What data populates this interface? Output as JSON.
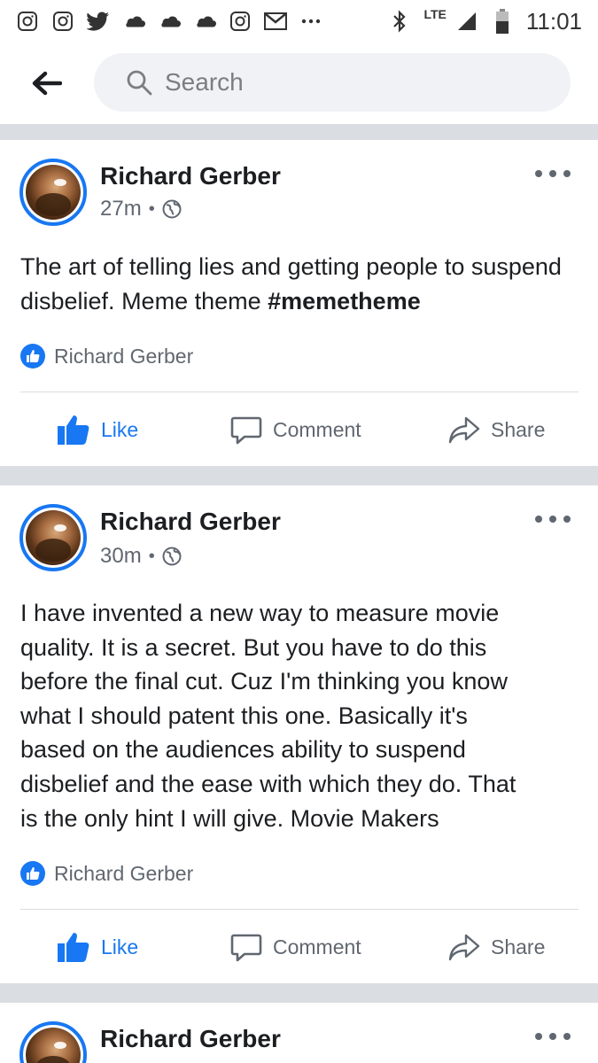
{
  "status_bar": {
    "time": "11:01",
    "network": "LTE",
    "icons": [
      "instagram-icon",
      "instagram-icon",
      "twitter-icon",
      "cloud-icon",
      "cloud-icon",
      "cloud-icon",
      "instagram-icon",
      "gmail-icon",
      "more-dots-icon",
      "bluetooth-icon",
      "signal-icon",
      "battery-icon"
    ]
  },
  "header": {
    "search_placeholder": "Search"
  },
  "posts": [
    {
      "author": "Richard Gerber",
      "time": "27m",
      "text_plain": "The art of telling lies and getting people to suspend disbelief. Meme theme ",
      "hashtag": "#memetheme",
      "reaction_name": "Richard Gerber",
      "like_label": "Like",
      "comment_label": "Comment",
      "share_label": "Share"
    },
    {
      "author": "Richard Gerber",
      "time": "30m",
      "text_lines": [
        "I have invented a new way to measure movie",
        "quality. It is a secret. But you have to do this",
        "before the final cut. Cuz I'm thinking you know",
        "what I should patent this one. Basically it's",
        "based on the audiences ability to suspend",
        "disbelief and the ease with which they do. That",
        "is the only hint I will give.  Movie Makers"
      ],
      "reaction_name": "Richard Gerber",
      "like_label": "Like",
      "comment_label": "Comment",
      "share_label": "Share"
    },
    {
      "author": "Richard Gerber"
    }
  ],
  "colors": {
    "accent": "#1877f2",
    "divider": "#dadde1",
    "search_bg": "#f0f2f5",
    "muted_text": "#606770"
  }
}
